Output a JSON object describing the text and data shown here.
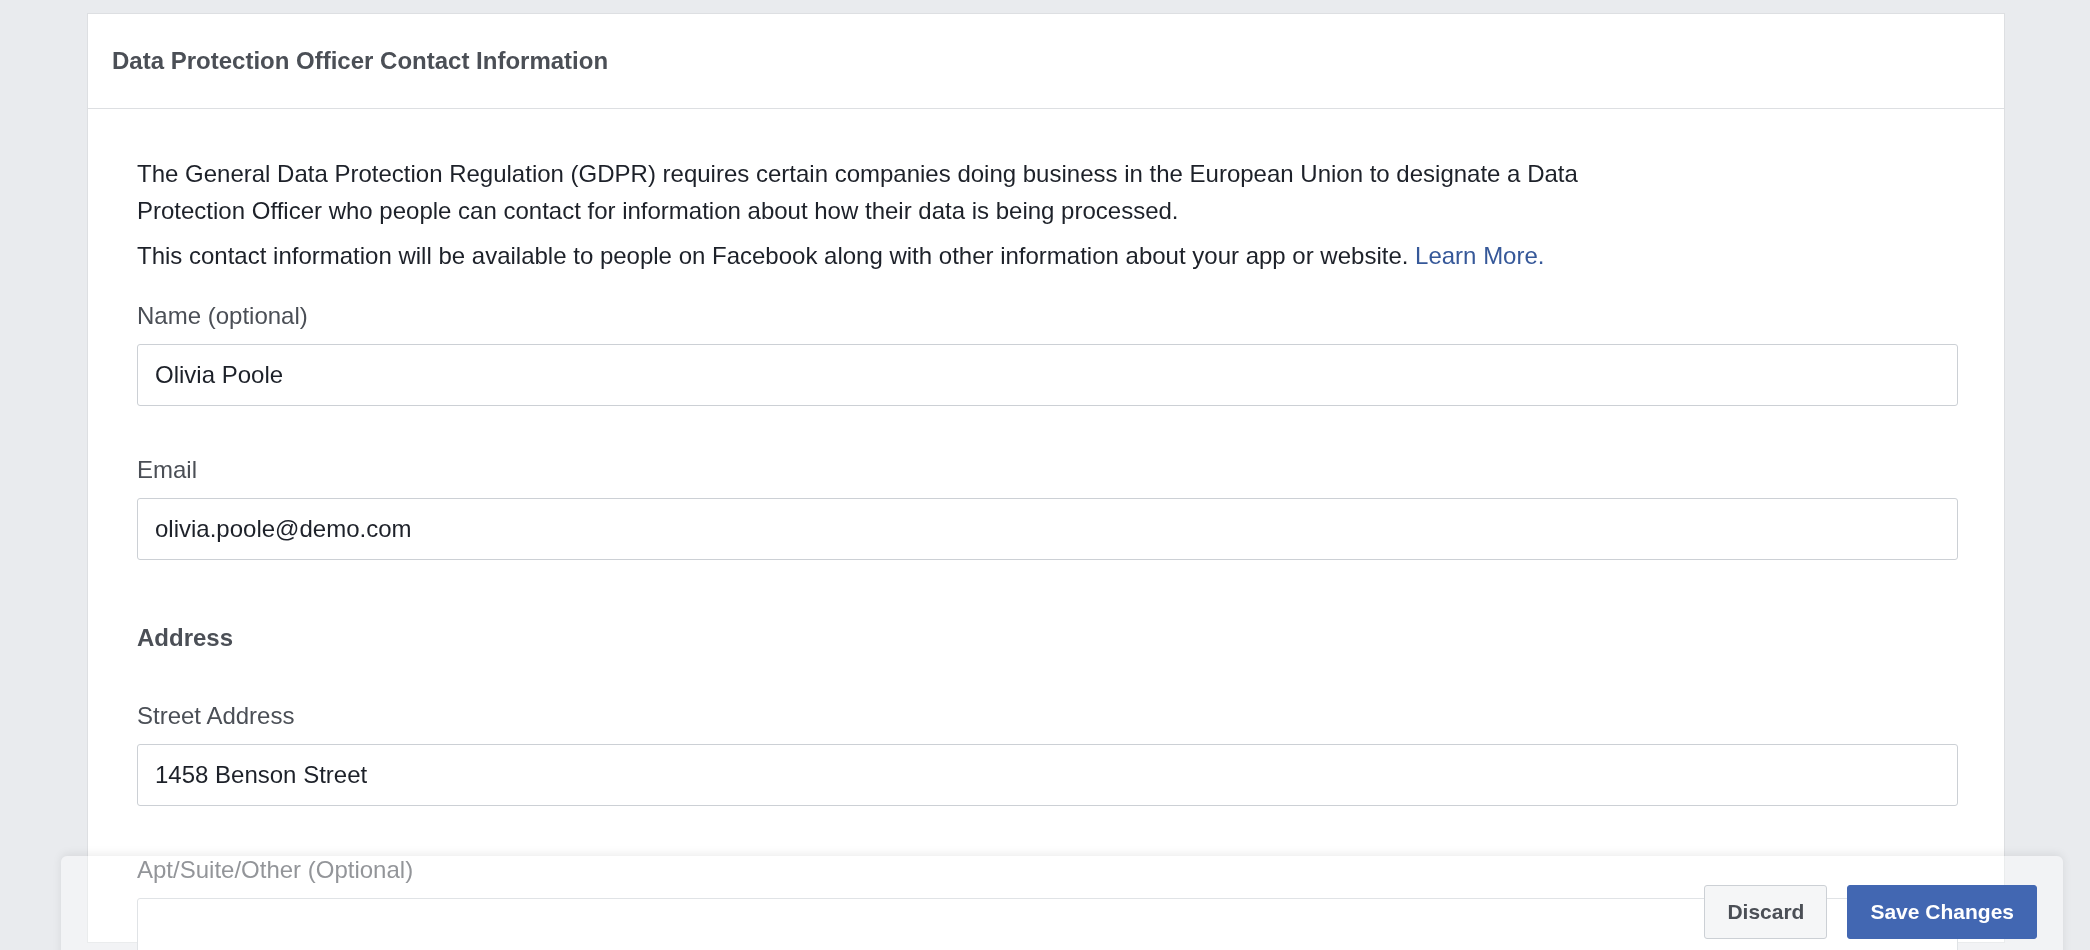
{
  "card": {
    "title": "Data Protection Officer Contact Information"
  },
  "description": [
    "The General Data Protection Regulation (GDPR) requires certain companies doing business in the European Union to designate a Data Protection Officer who people can contact for information about how their data is being processed.",
    "This contact information will be available to people on Facebook along with other information about your app or website."
  ],
  "learn_more_link": "Learn More.",
  "form": [
    {
      "kind": "field",
      "label": "Name (optional)",
      "value": "Olivia Poole"
    },
    {
      "kind": "field",
      "label": "Email",
      "value": "olivia.poole@demo.com"
    },
    {
      "kind": "heading",
      "label": "Address"
    },
    {
      "kind": "field",
      "label": "Street Address",
      "value": "1458 Benson Street"
    },
    {
      "kind": "field",
      "label": "Apt/Suite/Other (Optional)"
    }
  ],
  "footer_buttons": [
    {
      "label": "Discard",
      "kind": "secondary"
    },
    {
      "label": "Save Changes",
      "kind": "primary"
    }
  ]
}
